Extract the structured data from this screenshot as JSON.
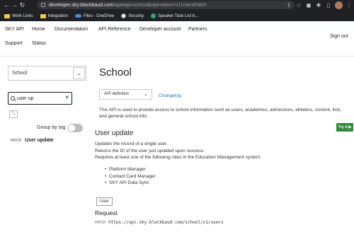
{
  "browser": {
    "url_host": "developer.sky.blackbaud.com",
    "url_path": "/api#api=school&operation=V1UsersPatch",
    "nav_back": "←",
    "nav_forward": "→",
    "nav_reload": "↻",
    "bookmarks": [
      {
        "label": "Work Links"
      },
      {
        "label": "Integration"
      },
      {
        "label": "Files - OneDrive"
      },
      {
        "label": "Security"
      },
      {
        "label": "Speaker Task List b..."
      }
    ]
  },
  "topnav": {
    "items": [
      "SKY API",
      "Home",
      "Documentation",
      "API Reference",
      "Developer account",
      "Partners",
      "Support",
      "Status"
    ],
    "sign_out": "Sign out"
  },
  "sidebar": {
    "api_select_value": "School",
    "search_value": "user up",
    "clear_glyph": "×",
    "collapse_glyph": "⤡",
    "group_by_tag_label": "Group by tag",
    "group_by_tag_on": false,
    "operation": {
      "method": "PATCH",
      "name": "User update"
    }
  },
  "main": {
    "title": "School",
    "definition_select": "API definition",
    "changelog": "Changelog",
    "description": "This API is used to provide access to school information such as users, academics, admissions, athletics, content, lists, and general school info.",
    "try_it": "Try it ▶",
    "operation_title": "User update",
    "op_line1": "Updates the record of a single user.",
    "op_line2": "Returns the ID of the user just updated upon success.",
    "op_line3": "Requires at least one of the following roles in the Education Management system:",
    "roles": [
      "Platform Manager",
      "Contact Card Manager",
      "SKY API Data Sync"
    ],
    "tag": "User",
    "request_title": "Request",
    "request_method": "PATCH",
    "request_url": "https://api.sky.blackbaud.com/school/v1/users"
  },
  "colors": {
    "chrome_bg": "#202124",
    "link": "#1a73b8",
    "try_it_bg": "#2e8b3e",
    "toggle_off": "#bdbdbd"
  }
}
